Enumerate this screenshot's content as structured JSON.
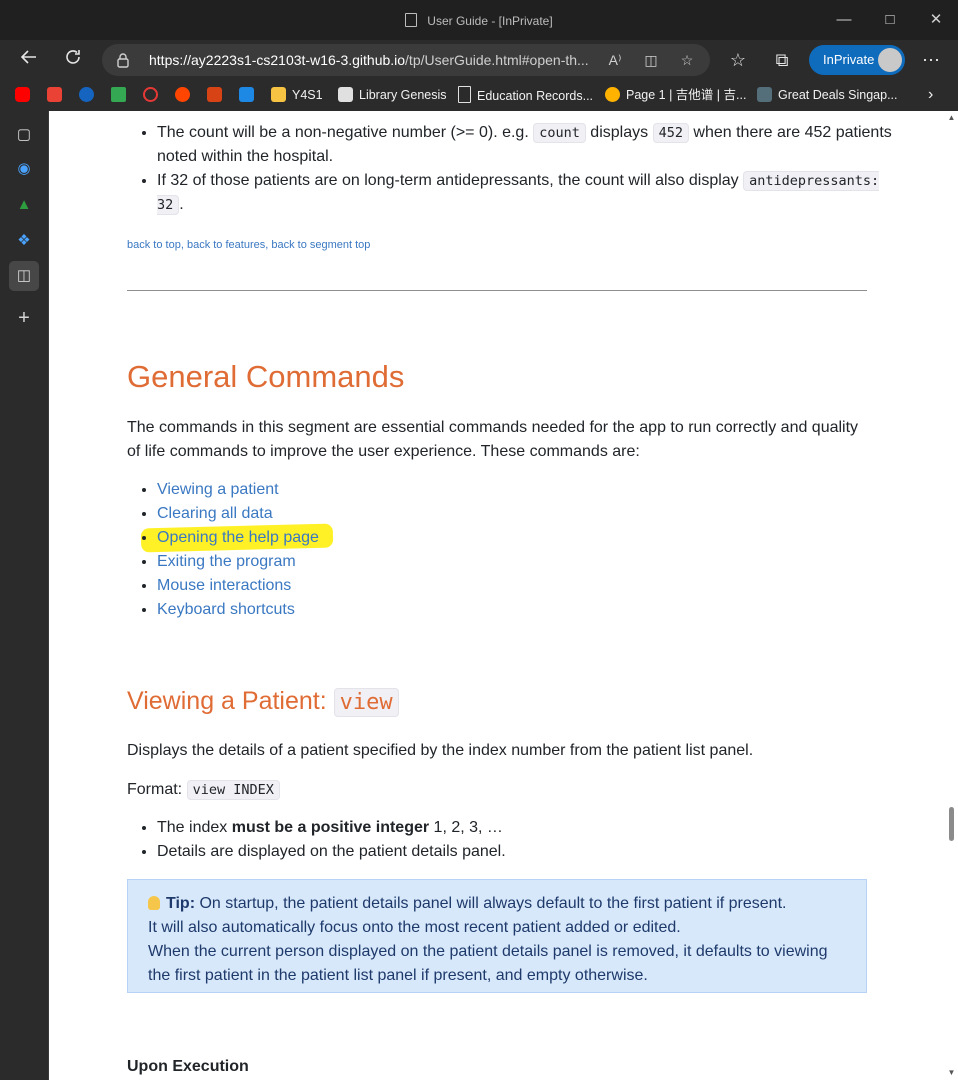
{
  "window": {
    "title": "User Guide - [InPrivate]"
  },
  "address_bar": {
    "url_host": "https://ay2223s1-cs2103t-w16-3.github.io",
    "url_path": "/tp/UserGuide.html#open-th...",
    "inprivate_label": "InPrivate",
    "read_aloud_glyph": "A⁾"
  },
  "bookmarks": [
    {
      "label": "Y4S1",
      "icon": "folder-icon"
    },
    {
      "label": "Library Genesis",
      "icon": "book-icon"
    },
    {
      "label": "Education Records...",
      "icon": "page-icon"
    },
    {
      "label": "Page 1 | 吉他谱 | 吉...",
      "icon": "guitar-icon"
    },
    {
      "label": "Great Deals Singap...",
      "icon": "gds-icon"
    }
  ],
  "content": {
    "count_bullets": {
      "b1_pre": "The count will be a non-negative number (>= 0). e.g. ",
      "b1_code1": "count",
      "b1_mid": " displays ",
      "b1_code2": "452",
      "b1_post": " when there are 452 patients noted within the hospital.",
      "b2_pre": "If 32 of those patients are on long-term antidepressants, the count will also display ",
      "b2_code": "antidepressants: 32",
      "b2_post": "."
    },
    "nav_links": {
      "top": "back to top",
      "features": "back to features",
      "segment": "back to segment top",
      "sep": ", "
    },
    "general_commands": {
      "heading": "General Commands",
      "intro": "The commands in this segment are essential commands needed for the app to run correctly and quality of life commands to improve the user experience. These commands are:",
      "links": [
        "Viewing a patient",
        "Clearing all data",
        "Opening the help page",
        "Exiting the program",
        "Mouse interactions",
        "Keyboard shortcuts"
      ]
    },
    "viewing": {
      "heading_text": "Viewing a Patient: ",
      "heading_code": "view",
      "description": "Displays the details of a patient specified by the index number from the patient list panel.",
      "format_label": "Format: ",
      "format_code": "view INDEX",
      "bullet1_pre": "The index ",
      "bullet1_bold": "must be a positive integer",
      "bullet1_post": " 1, 2, 3, …",
      "bullet2": "Details are displayed on the patient details panel.",
      "tip_label": "Tip:",
      "tip_line1": " On startup, the patient details panel will always default to the first patient if present.",
      "tip_line2": "It will also automatically focus onto the most recent patient added or edited.",
      "tip_line3": "When the current person displayed on the patient details panel is removed, it defaults to viewing the first patient in the patient list panel if present, and empty otherwise.",
      "upon_execution": "Upon Execution"
    }
  },
  "colors": {
    "heading": "#e06c35",
    "link": "#3a78c2",
    "highlight": "#ffee00",
    "tip_bg": "#d8e8fb"
  }
}
